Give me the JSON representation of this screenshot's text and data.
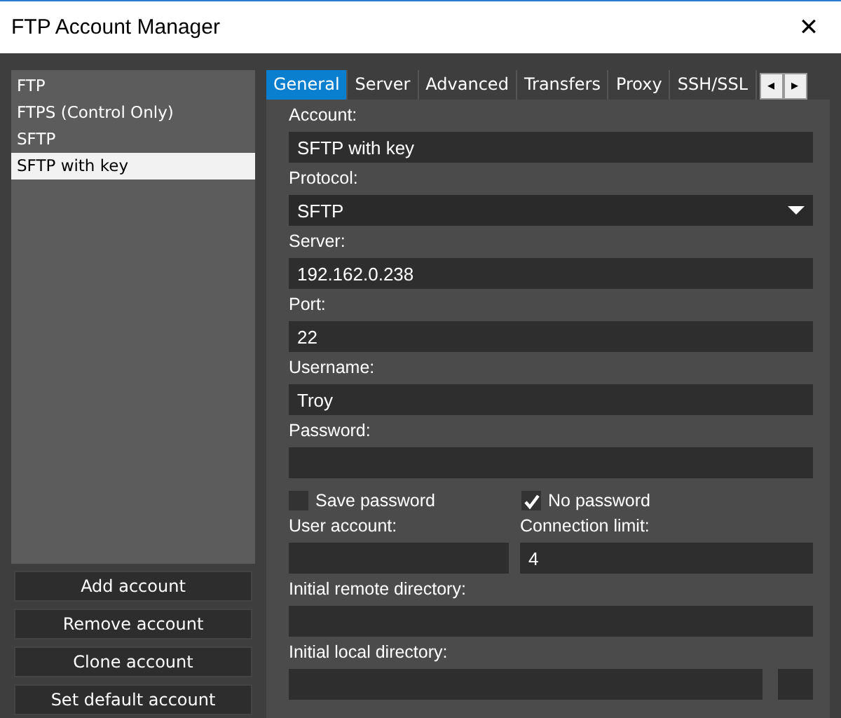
{
  "window": {
    "title": "FTP Account Manager",
    "close": "✕"
  },
  "accounts": [
    {
      "label": "FTP",
      "selected": false
    },
    {
      "label": "FTPS (Control Only)",
      "selected": false
    },
    {
      "label": "SFTP",
      "selected": false
    },
    {
      "label": "SFTP with key",
      "selected": true
    }
  ],
  "account_buttons": [
    "Add account",
    "Remove account",
    "Clone account",
    "Set default account"
  ],
  "tabs": [
    {
      "label": "General",
      "selected": true
    },
    {
      "label": "Server",
      "selected": false
    },
    {
      "label": "Advanced",
      "selected": false
    },
    {
      "label": "Transfers",
      "selected": false
    },
    {
      "label": "Proxy",
      "selected": false
    },
    {
      "label": "SSH/SSL",
      "selected": false
    }
  ],
  "tab_scroll": [
    "◂",
    "▸"
  ],
  "form": [
    {
      "kind": "text",
      "label": "Account:",
      "value": "SFTP with key"
    },
    {
      "kind": "select",
      "label": "Protocol:",
      "value": "SFTP"
    },
    {
      "kind": "text",
      "label": "Server:",
      "value": "192.162.0.238"
    },
    {
      "kind": "text",
      "label": "Port:",
      "value": "22"
    },
    {
      "kind": "text",
      "label": "Username:",
      "value": "Troy"
    },
    {
      "kind": "text",
      "label": "Password:"
    },
    {
      "kind": "checks",
      "items": [
        {
          "label": "Save password",
          "checked": false
        },
        {
          "label": "No password",
          "checked": true
        }
      ]
    },
    {
      "kind": "pair",
      "items": [
        {
          "label": "User account:"
        },
        {
          "label": "Connection limit:",
          "value": "4"
        }
      ]
    },
    {
      "kind": "text",
      "label": "Initial remote directory:"
    },
    {
      "kind": "browse",
      "label": "Initial local directory:"
    }
  ]
}
